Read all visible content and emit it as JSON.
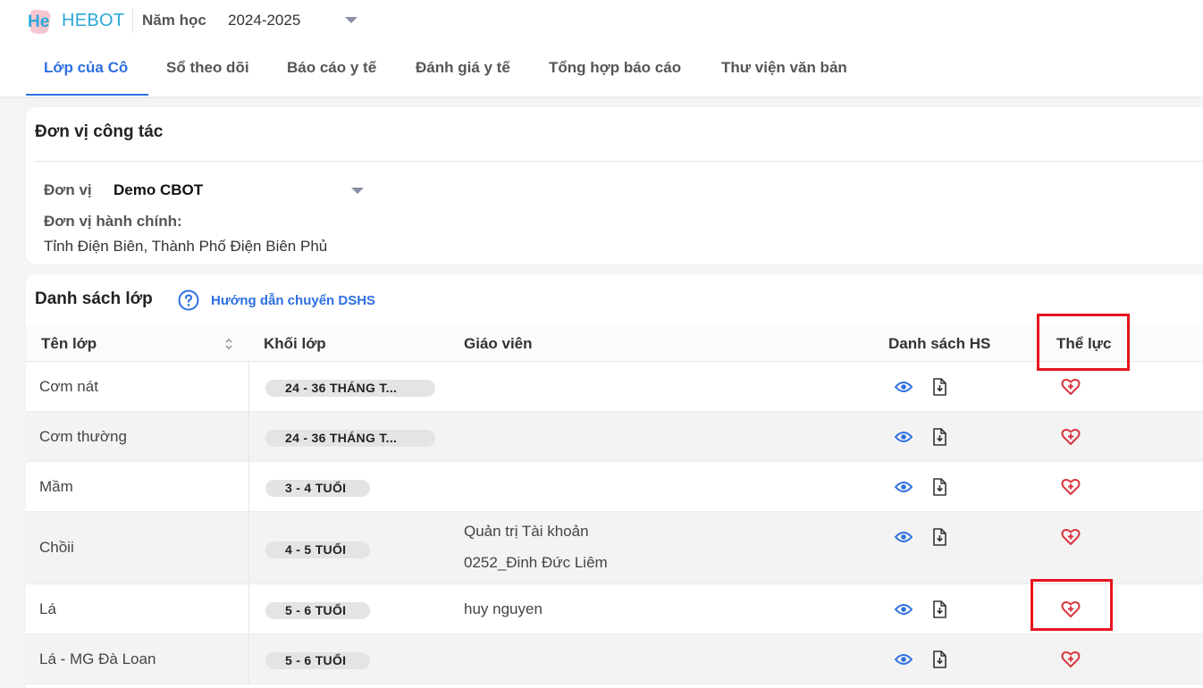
{
  "header": {
    "logo_text": "HEBOT",
    "year_label": "Năm học",
    "year_value": "2024-2025"
  },
  "tabs": [
    {
      "label": "Lớp của Cô",
      "active": true
    },
    {
      "label": "Sổ theo dõi",
      "active": false
    },
    {
      "label": "Báo cáo y tế",
      "active": false
    },
    {
      "label": "Đánh giá y tế",
      "active": false
    },
    {
      "label": "Tổng hợp báo cáo",
      "active": false
    },
    {
      "label": "Thư viện văn bản",
      "active": false
    }
  ],
  "work_unit": {
    "title": "Đơn vị công tác",
    "unit_label": "Đơn vị",
    "unit_value": "Demo CBOT",
    "admin_label": "Đơn vị hành chính:",
    "admin_value": "Tỉnh Điện Biên, Thành Phố Điện Biên Phủ"
  },
  "class_list": {
    "title": "Danh sách lớp",
    "help_link": "Hướng dẫn chuyển DSHS",
    "columns": [
      "Tên lớp",
      "Khối lớp",
      "Giáo viên",
      "Danh sách HS",
      "Thể lực"
    ],
    "rows": [
      {
        "name": "Cơm nát",
        "grade": "24 - 36 THÁNG T...",
        "teachers": []
      },
      {
        "name": "Cơm thường",
        "grade": "24 - 36 THÁNG T...",
        "teachers": []
      },
      {
        "name": "Mầm",
        "grade": "3 - 4 TUỔI",
        "teachers": []
      },
      {
        "name": "Chồii",
        "grade": "4 - 5 TUỔI",
        "teachers": [
          "Quản trị Tài khoản",
          "0252_Đinh Đức Liêm"
        ]
      },
      {
        "name": "Lá",
        "grade": "5 - 6 TUỔI",
        "teachers": [
          "huy nguyen"
        ]
      },
      {
        "name": "Lá - MG Đà Loan",
        "grade": "5 - 6 TUỔI",
        "teachers": []
      }
    ]
  },
  "colors": {
    "accent": "#2d6fe0",
    "logo": "#2ba8d9",
    "heart": "#d9363e",
    "highlight": "#e8141e"
  },
  "icons": [
    "help-icon",
    "sort-icon",
    "eye-icon",
    "download-file-icon",
    "heart-pulse-icon",
    "chevron-down-icon"
  ]
}
